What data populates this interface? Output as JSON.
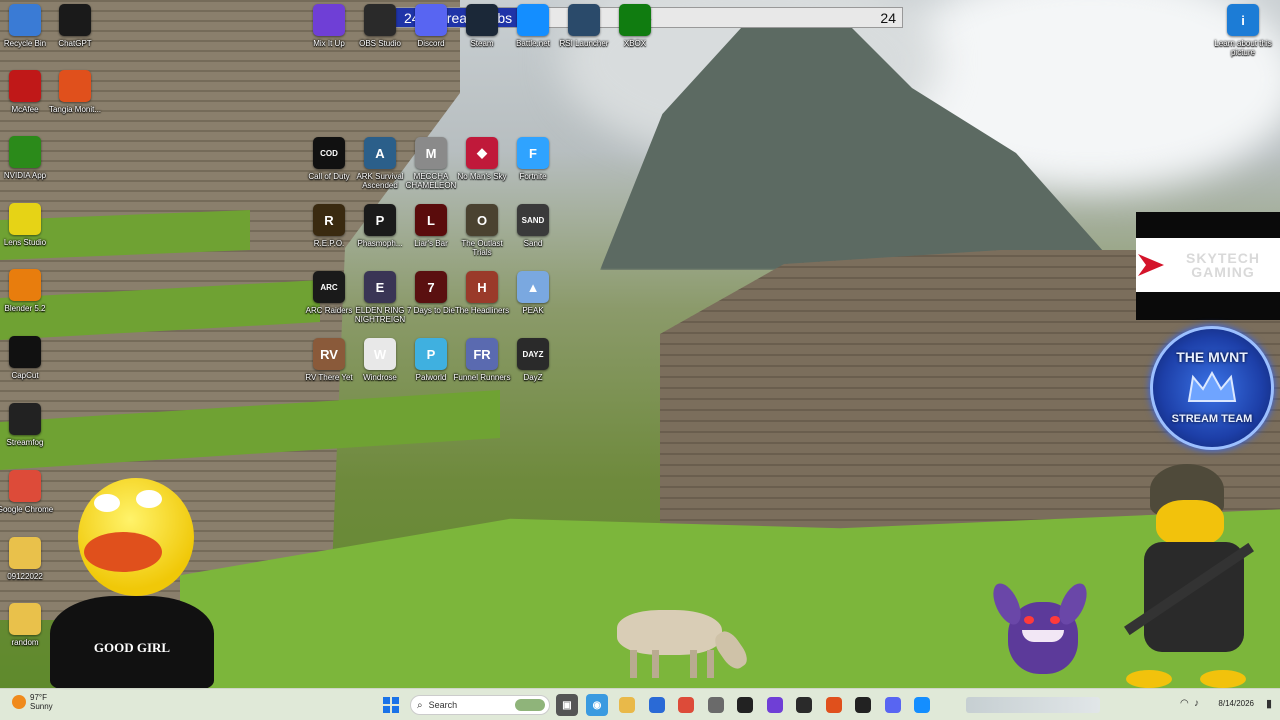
{
  "stream_subs": {
    "title": "24hr stream subs",
    "current": "6",
    "goal": "24",
    "progress": 0.25
  },
  "desktop_left": [
    {
      "label": "Recycle Bin",
      "icon": "recycle-bin-icon",
      "color": "#3a7bd5"
    },
    {
      "label": "ChatGPT",
      "icon": "chatgpt-icon",
      "color": "#1a1a1a"
    },
    {
      "label": "McAfee",
      "icon": "mcafee-icon",
      "color": "#c01818"
    },
    {
      "label": "Tangia Monit...",
      "icon": "tangia-icon",
      "color": "#e0501c"
    },
    {
      "label": "NVIDIA App",
      "icon": "nvidia-icon",
      "color": "#2b8a1a"
    },
    {
      "label": "Lens Studio",
      "icon": "lens-studio-icon",
      "color": "#e6d316"
    },
    {
      "label": "Blender 5.2",
      "icon": "blender-icon",
      "color": "#e87d0d"
    },
    {
      "label": "CapCut",
      "icon": "capcut-icon",
      "color": "#111111"
    },
    {
      "label": "Streamfog",
      "icon": "streamfog-icon",
      "color": "#222222"
    },
    {
      "label": "Google Chrome",
      "icon": "chrome-icon",
      "color": "#dd4b39"
    },
    {
      "label": "09122022",
      "icon": "folder-icon",
      "color": "#e9c14b"
    },
    {
      "label": "random",
      "icon": "folder-icon",
      "color": "#e9c14b"
    }
  ],
  "desktop_top": [
    {
      "label": "Mix It Up",
      "icon": "mixitup-icon",
      "color": "#6f3fd6"
    },
    {
      "label": "OBS Studio",
      "icon": "obs-icon",
      "color": "#2a2a2a"
    },
    {
      "label": "Discord",
      "icon": "discord-icon",
      "color": "#5865f2"
    },
    {
      "label": "Steam",
      "icon": "steam-icon",
      "color": "#1b2838"
    },
    {
      "label": "Battle.net",
      "icon": "battlenet-icon",
      "color": "#148eff"
    },
    {
      "label": "RSI Launcher",
      "icon": "rsi-icon",
      "color": "#2a4a6a"
    },
    {
      "label": "XBOX",
      "icon": "xbox-icon",
      "color": "#107c10"
    }
  ],
  "desktop_games": [
    {
      "label": "Call of Duty",
      "icon": "call-of-duty-icon",
      "color": "#111111",
      "glyph": "COD"
    },
    {
      "label": "ARK Survival Ascended",
      "icon": "ark-icon",
      "color": "#2b5f8a",
      "glyph": "A"
    },
    {
      "label": "MECCHA CHAMELEON",
      "icon": "meccha-icon",
      "color": "#8a8a8a",
      "glyph": "M"
    },
    {
      "label": "No Man's Sky",
      "icon": "no-mans-sky-icon",
      "color": "#c0193a",
      "glyph": "◆"
    },
    {
      "label": "Fortnite",
      "icon": "fortnite-icon",
      "color": "#2fa3ff",
      "glyph": "F"
    },
    {
      "label": "R.E.P.O.",
      "icon": "repo-icon",
      "color": "#3a2a10",
      "glyph": "R"
    },
    {
      "label": "Phasmoph...",
      "icon": "phasmophobia-icon",
      "color": "#1a1a1a",
      "glyph": "P"
    },
    {
      "label": "Liar's Bar",
      "icon": "liars-bar-icon",
      "color": "#5a0c0c",
      "glyph": "L"
    },
    {
      "label": "The Outlast Trials",
      "icon": "outlast-icon",
      "color": "#4a4230",
      "glyph": "O"
    },
    {
      "label": "Sand",
      "icon": "sand-icon",
      "color": "#3a3a3a",
      "glyph": "SAND"
    },
    {
      "label": "ARC Raiders",
      "icon": "arc-raiders-icon",
      "color": "#1a1a1a",
      "glyph": "ARC"
    },
    {
      "label": "ELDEN RING NIGHTREIGN",
      "icon": "elden-ring-icon",
      "color": "#3a3555",
      "glyph": "E"
    },
    {
      "label": "7 Days to Die",
      "icon": "seven-days-icon",
      "color": "#5a1010",
      "glyph": "7"
    },
    {
      "label": "The Headliners",
      "icon": "headliners-icon",
      "color": "#9a3a2a",
      "glyph": "H"
    },
    {
      "label": "PEAK",
      "icon": "peak-icon",
      "color": "#7aa8e0",
      "glyph": "▲"
    },
    {
      "label": "RV There Yet",
      "icon": "rv-there-yet-icon",
      "color": "#8a5a3a",
      "glyph": "RV"
    },
    {
      "label": "Windrose",
      "icon": "windrose-icon",
      "color": "#e8e8e8",
      "glyph": "W"
    },
    {
      "label": "Palworld",
      "icon": "palworld-icon",
      "color": "#3fb0e0",
      "glyph": "P"
    },
    {
      "label": "Funnel Runners",
      "icon": "funnel-runners-icon",
      "color": "#5a6ab0",
      "glyph": "FR"
    },
    {
      "label": "DayZ",
      "icon": "dayz-icon",
      "color": "#2a2a2a",
      "glyph": "DAYZ"
    }
  ],
  "learn_about": {
    "label": "Learn about this picture",
    "icon": "learn-about-picture-icon",
    "color": "#1c7cd6"
  },
  "overlays": {
    "skytech": "SKYTECH GAMING",
    "mvnt_top": "THE MVNT",
    "mvnt_bottom": "STREAM TEAM",
    "duck_shirt": "GOOD GIRL"
  },
  "taskbar": {
    "weather_temp": "97°F",
    "weather_desc": "Sunny",
    "search_placeholder": "Search",
    "date": "8/14/2026",
    "apps": [
      {
        "icon": "explorer-icon",
        "color": "#e9b949"
      },
      {
        "icon": "store-icon",
        "color": "#2a6ad6"
      },
      {
        "icon": "chrome-icon",
        "color": "#dd4b39"
      },
      {
        "icon": "settings-icon",
        "color": "#6a6a6a"
      },
      {
        "icon": "terminal-icon",
        "color": "#222222"
      },
      {
        "icon": "mixitup-icon",
        "color": "#6f3fd6"
      },
      {
        "icon": "obs-icon",
        "color": "#2a2a2a"
      },
      {
        "icon": "tangia-icon",
        "color": "#e0501c"
      },
      {
        "icon": "streamfog-icon",
        "color": "#222222"
      },
      {
        "icon": "discord-icon",
        "color": "#5865f2"
      },
      {
        "icon": "battlenet-icon",
        "color": "#148eff"
      }
    ]
  }
}
